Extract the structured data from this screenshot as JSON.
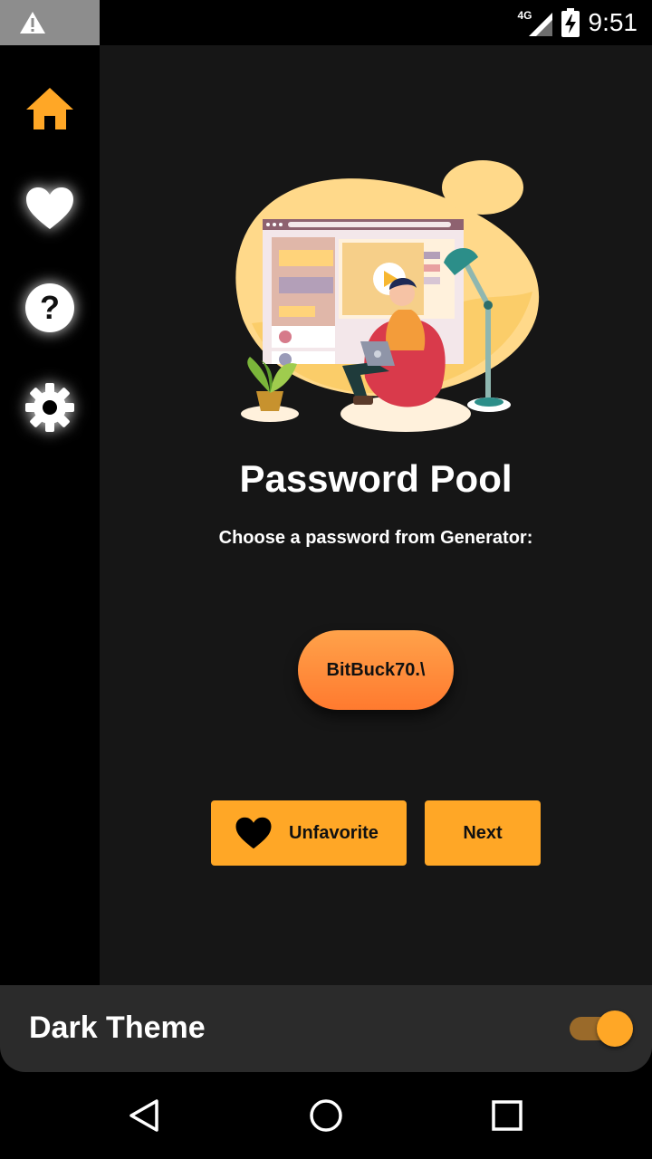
{
  "status_bar": {
    "warning_icon": "warning-triangle-icon",
    "network_label": "4G",
    "time": "9:51"
  },
  "sidebar": {
    "items": [
      {
        "icon": "home-icon",
        "active": true,
        "color": "#ffa726"
      },
      {
        "icon": "heart-icon",
        "active": false,
        "color": "#ffffff"
      },
      {
        "icon": "help-icon",
        "active": false,
        "color": "#ffffff"
      },
      {
        "icon": "gear-icon",
        "active": false,
        "color": "#ffffff"
      }
    ]
  },
  "main": {
    "title": "Password Pool",
    "subtitle": "Choose a password from Generator:",
    "password": "BitBuck70.\\",
    "unfavorite_label": "Unfavorite",
    "next_label": "Next"
  },
  "theme": {
    "label": "Dark Theme",
    "enabled": true
  },
  "colors": {
    "accent": "#ffa726",
    "pill_gradient_top": "#ffa24a",
    "pill_gradient_bottom": "#ff7a2f",
    "background": "#161616",
    "sidebar": "#000000"
  }
}
